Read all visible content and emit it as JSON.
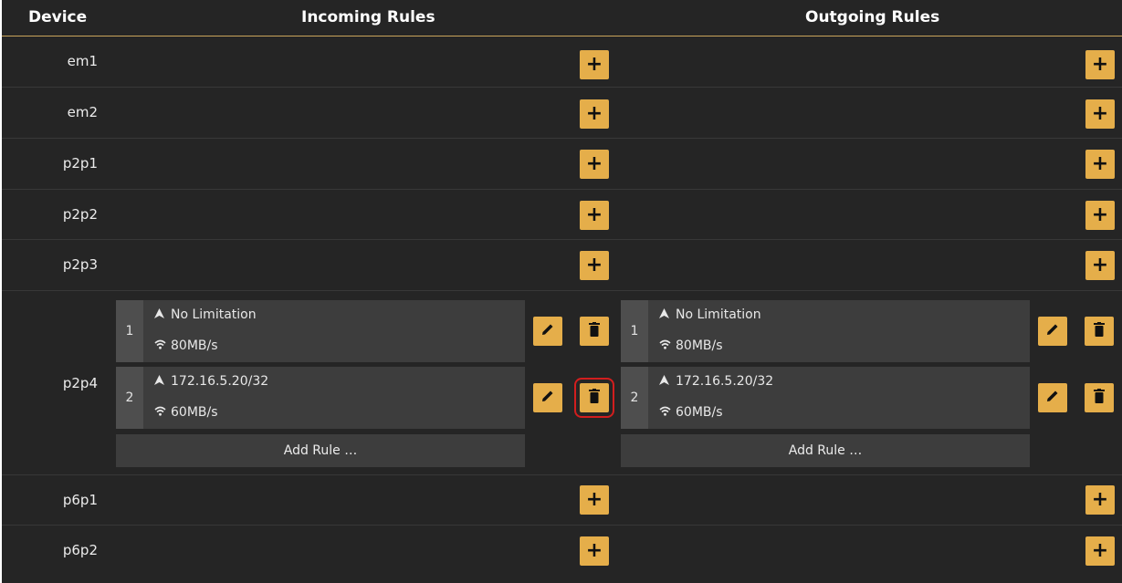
{
  "headers": {
    "device": "Device",
    "incoming": "Incoming Rules",
    "outgoing": "Outgoing Rules"
  },
  "devices": [
    {
      "name": "em1"
    },
    {
      "name": "em2"
    },
    {
      "name": "p2p1"
    },
    {
      "name": "p2p2"
    },
    {
      "name": "p2p3"
    },
    {
      "name": "p2p4"
    },
    {
      "name": "p6p1"
    },
    {
      "name": "p6p2"
    }
  ],
  "p2p4": {
    "incoming": [
      {
        "num": "1",
        "target": "No Limitation",
        "rate": "80MB/s"
      },
      {
        "num": "2",
        "target": "172.16.5.20/32",
        "rate": "60MB/s"
      }
    ],
    "outgoing": [
      {
        "num": "1",
        "target": "No Limitation",
        "rate": "80MB/s"
      },
      {
        "num": "2",
        "target": "172.16.5.20/32",
        "rate": "60MB/s"
      }
    ],
    "add_rule_label": "Add Rule …"
  },
  "icons": {
    "add": "plus-icon",
    "edit": "pencil-icon",
    "delete": "trash-icon",
    "target": "arrow-up-icon",
    "rate": "wifi-icon"
  },
  "colors": {
    "accent": "#e5ae4a",
    "selection": "#d21e1e",
    "background": "#252525"
  }
}
